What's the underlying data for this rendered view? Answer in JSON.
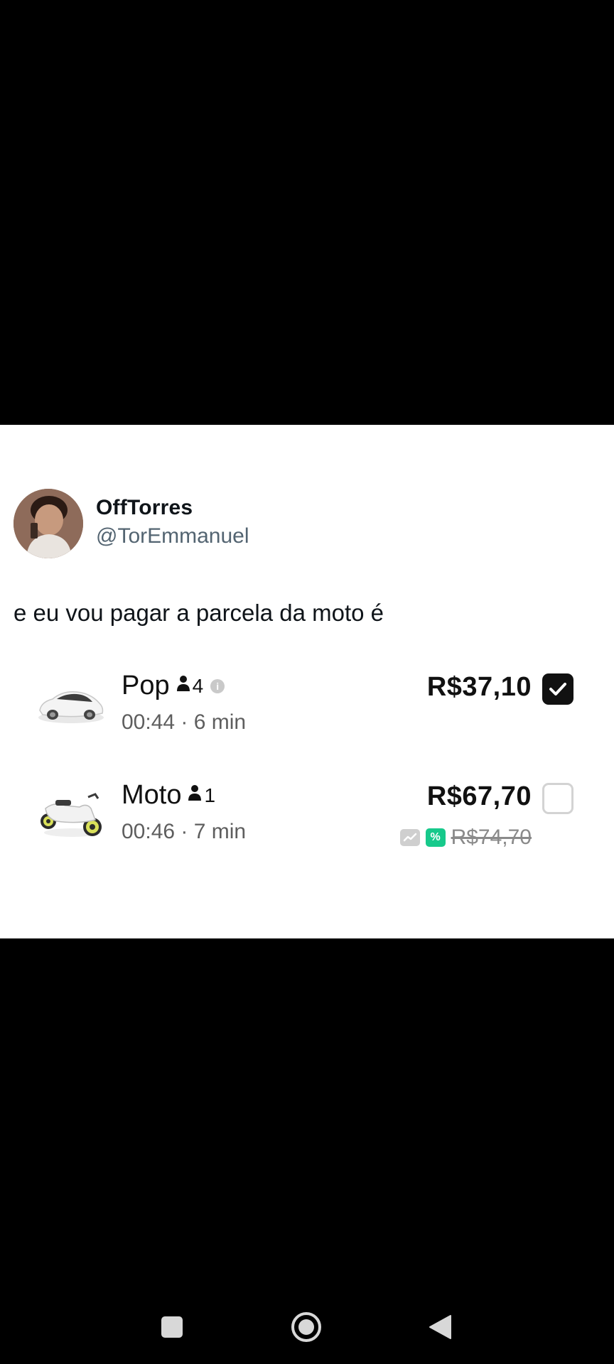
{
  "tweet": {
    "display_name": "OffTorres",
    "handle": "@TorEmmanuel",
    "text": "e eu vou pagar a parcela da moto é"
  },
  "rides": [
    {
      "name": "Pop",
      "capacity": "4",
      "eta": "00:44 · 6 min",
      "price": "R$37,10",
      "selected": true,
      "vehicle_icon": "car-image"
    },
    {
      "name": "Moto",
      "capacity": "1",
      "eta": "00:46 · 7 min",
      "price": "R$67,70",
      "old_price": "R$74,70",
      "selected": false,
      "vehicle_icon": "motorcycle-image"
    }
  ],
  "nav": {
    "buttons": [
      "recents-icon",
      "home-icon",
      "back-icon"
    ]
  },
  "colors": {
    "promo_green": "#17c98b",
    "text_primary": "#0f1419",
    "text_secondary": "#536471"
  }
}
